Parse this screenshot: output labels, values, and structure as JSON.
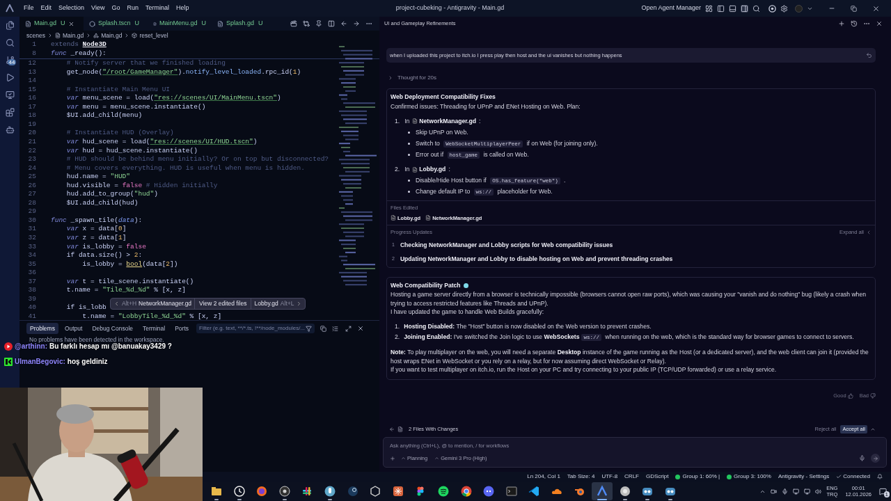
{
  "window": {
    "title": "project-cubeking - Antigravity - Main.gd"
  },
  "menu": [
    "File",
    "Edit",
    "Selection",
    "View",
    "Go",
    "Run",
    "Terminal",
    "Help"
  ],
  "titlebar": {
    "agent_manager": "Open Agent Manager"
  },
  "activity_bar": {
    "source_control_badge": "44"
  },
  "editor": {
    "tabs": [
      {
        "label": "Main.gd",
        "status": "U",
        "kind": "script",
        "selected": true
      },
      {
        "label": "Splash.tscn",
        "status": "U",
        "kind": "scene",
        "selected": false
      },
      {
        "label": "MainMenu.gd",
        "status": "U",
        "kind": "script",
        "selected": false
      },
      {
        "label": "Splash.gd",
        "status": "U",
        "kind": "script",
        "selected": false
      }
    ],
    "breadcrumb": [
      {
        "kind": "folder",
        "text": "scenes"
      },
      {
        "kind": "file",
        "text": "Main.gd"
      },
      {
        "kind": "class",
        "text": "Main.gd"
      },
      {
        "kind": "method",
        "text": "reset_level"
      }
    ],
    "sticky_lines": [
      {
        "number": "1",
        "tokens": [
          {
            "kind": "dim",
            "text": "extends "
          },
          {
            "kind": "type",
            "text": "Node3D"
          }
        ]
      },
      {
        "number": "8",
        "tokens": [
          {
            "kind": "keyword",
            "text": "func"
          },
          {
            "kind": "plain",
            "text": " _ready():"
          }
        ]
      }
    ],
    "lines": [
      {
        "number": "12",
        "tokens": [
          {
            "kind": "comment",
            "text": "    # Notify server that we finished loading"
          }
        ]
      },
      {
        "number": "13",
        "tokens": [
          {
            "kind": "plain",
            "text": "    get_node("
          },
          {
            "kind": "string",
            "text": "\"/root/GameManager\""
          },
          {
            "kind": "plain",
            "text": ")."
          },
          {
            "kind": "method",
            "text": "notify_level_loaded"
          },
          {
            "kind": "plain",
            "text": ".rpc_id("
          },
          {
            "kind": "number",
            "text": "1"
          },
          {
            "kind": "plain",
            "text": ")"
          }
        ]
      },
      {
        "number": "14"
      },
      {
        "number": "15",
        "tokens": [
          {
            "kind": "comment",
            "text": "    # Instantiate Main Menu UI"
          }
        ]
      },
      {
        "number": "16",
        "tokens": [
          {
            "kind": "keyword",
            "text": "    var"
          },
          {
            "kind": "plain",
            "text": " menu_scene = load("
          },
          {
            "kind": "string",
            "text": "\"res://scenes/UI/MainMenu.tscn\""
          },
          {
            "kind": "plain",
            "text": ")"
          }
        ]
      },
      {
        "number": "17",
        "tokens": [
          {
            "kind": "keyword",
            "text": "    var"
          },
          {
            "kind": "plain",
            "text": " menu = menu_scene.instantiate()"
          }
        ]
      },
      {
        "number": "18",
        "tokens": [
          {
            "kind": "plain",
            "text": "    $UI.add_child(menu)"
          }
        ]
      },
      {
        "number": "19"
      },
      {
        "number": "20",
        "tokens": [
          {
            "kind": "comment",
            "text": "    # Instantiate HUD (Overlay)"
          }
        ]
      },
      {
        "number": "21",
        "tokens": [
          {
            "kind": "keyword",
            "text": "    var"
          },
          {
            "kind": "plain",
            "text": " hud_scene = load("
          },
          {
            "kind": "string",
            "text": "\"res://scenes/UI/HUD.tscn\""
          },
          {
            "kind": "plain",
            "text": ")"
          }
        ]
      },
      {
        "number": "22",
        "tokens": [
          {
            "kind": "keyword",
            "text": "    var"
          },
          {
            "kind": "plain",
            "text": " hud = hud_scene.instantiate()"
          }
        ]
      },
      {
        "number": "23",
        "tokens": [
          {
            "kind": "comment",
            "text": "    # HUD should be behind menu initially? Or on top but disconnected?"
          }
        ]
      },
      {
        "number": "24",
        "tokens": [
          {
            "kind": "comment",
            "text": "    # Menu covers everything. HUD is useful when menu is hidden."
          }
        ]
      },
      {
        "number": "25",
        "tokens": [
          {
            "kind": "plain",
            "text": "    hud.name = "
          },
          {
            "kind": "string2",
            "text": "\"HUD\""
          }
        ]
      },
      {
        "number": "26",
        "tokens": [
          {
            "kind": "plain",
            "text": "    hud.visible = "
          },
          {
            "kind": "bool",
            "text": "false"
          },
          {
            "kind": "comment",
            "text": " # Hidden initially"
          }
        ]
      },
      {
        "number": "27",
        "tokens": [
          {
            "kind": "plain",
            "text": "    hud.add_to_group("
          },
          {
            "kind": "string2",
            "text": "\"hud\""
          },
          {
            "kind": "plain",
            "text": ")"
          }
        ]
      },
      {
        "number": "28",
        "tokens": [
          {
            "kind": "plain",
            "text": "    $UI.add_child(hud)"
          }
        ]
      },
      {
        "number": "29"
      },
      {
        "number": "30",
        "tokens": [
          {
            "kind": "keyword",
            "text": "func"
          },
          {
            "kind": "plain",
            "text": " _spawn_tile("
          },
          {
            "kind": "param",
            "text": "data"
          },
          {
            "kind": "plain",
            "text": "):"
          }
        ]
      },
      {
        "number": "31",
        "tokens": [
          {
            "kind": "keyword",
            "text": "    var"
          },
          {
            "kind": "plain",
            "text": " x = data["
          },
          {
            "kind": "number",
            "text": "0"
          },
          {
            "kind": "plain",
            "text": "]"
          }
        ]
      },
      {
        "number": "32",
        "tokens": [
          {
            "kind": "keyword",
            "text": "    var"
          },
          {
            "kind": "plain",
            "text": " z = data["
          },
          {
            "kind": "number",
            "text": "1"
          },
          {
            "kind": "plain",
            "text": "]"
          }
        ]
      },
      {
        "number": "33",
        "tokens": [
          {
            "kind": "keyword",
            "text": "    var"
          },
          {
            "kind": "plain",
            "text": " is_lobby = "
          },
          {
            "kind": "bool",
            "text": "false"
          }
        ]
      },
      {
        "number": "34",
        "tokens": [
          {
            "kind": "plain",
            "text": "    if data.size() > "
          },
          {
            "kind": "number",
            "text": "2"
          },
          {
            "kind": "plain",
            "text": ":"
          }
        ]
      },
      {
        "number": "35",
        "tokens": [
          {
            "kind": "plain",
            "text": "        is_lobby = "
          },
          {
            "kind": "call",
            "text": "bool"
          },
          {
            "kind": "plain",
            "text": "(data["
          },
          {
            "kind": "number",
            "text": "2"
          },
          {
            "kind": "plain",
            "text": "])"
          }
        ]
      },
      {
        "number": "36"
      },
      {
        "number": "37",
        "tokens": [
          {
            "kind": "keyword",
            "text": "    var"
          },
          {
            "kind": "plain",
            "text": " t = tile_scene.instantiate()"
          }
        ]
      },
      {
        "number": "38",
        "tokens": [
          {
            "kind": "plain",
            "text": "    t.name = "
          },
          {
            "kind": "string2",
            "text": "\"Tile_%d_%d\""
          },
          {
            "kind": "plain",
            "text": " % [x, z]"
          }
        ]
      },
      {
        "number": "39"
      },
      {
        "number": "40",
        "tokens": [
          {
            "kind": "plain",
            "text": "    if is_lobb"
          }
        ]
      },
      {
        "number": "41",
        "tokens": [
          {
            "kind": "plain",
            "text": "        t.name = "
          },
          {
            "kind": "string2",
            "text": "\"LobbyTile_%d_%d\""
          },
          {
            "kind": "plain",
            "text": " % [x, z]"
          }
        ]
      }
    ],
    "popup": {
      "prev_shortcut": "Alt+H",
      "prev_file": "NetworkManager.gd",
      "middle": "View 2 edited files",
      "next_file": "Lobby.gd",
      "next_shortcut": "Alt+L"
    }
  },
  "panel": {
    "tabs": [
      {
        "label": "Problems",
        "selected": true
      },
      {
        "label": "Output",
        "selected": false
      },
      {
        "label": "Debug Console",
        "selected": false
      },
      {
        "label": "Terminal",
        "selected": false
      },
      {
        "label": "Ports",
        "selected": false
      }
    ],
    "filter_placeholder": "Filter (e.g. text, **/*.ts, !**/node_modules/...",
    "message": "No problems have been detected in the workspace."
  },
  "chat_overlay": [
    {
      "kind": "youtube",
      "user": "@arthinn:",
      "text": "Bu farklı hesap mı @banuakay3429 ?"
    },
    {
      "kind": "kick",
      "user": "UlmanBegovic:",
      "text": "hoş geldiniz"
    }
  ],
  "webcam": {
    "kind": "picture"
  },
  "agent": {
    "title": "UI and Gameplay Refinements",
    "user_message": "when I uploaded this project to itch.io I press play then host and the ui vanishes but nothing happens",
    "thought": {
      "text": "Thought for 20s",
      "expanded": false
    },
    "plan": {
      "title": "Web Deployment Compatibility Fixes",
      "intro": "Confirmed issues: Threading for UPnP and ENet Hosting on Web. Plan:",
      "steps": [
        {
          "number": "1.",
          "prefix": "In",
          "file": "NetworkManager.gd",
          "suffix": ":",
          "bullets": [
            [
              {
                "kind": "text",
                "text": "Skip UPnP on Web."
              }
            ],
            [
              {
                "kind": "text",
                "text": "Switch to "
              },
              {
                "kind": "code",
                "text": "WebSocketMultiplayerPeer"
              },
              {
                "kind": "text",
                "text": " if on Web (for joining only)."
              }
            ],
            [
              {
                "kind": "text",
                "text": "Error out if "
              },
              {
                "kind": "code",
                "text": "host_game"
              },
              {
                "kind": "text",
                "text": " is called on Web."
              }
            ]
          ]
        },
        {
          "number": "2.",
          "prefix": "In",
          "file": "Lobby.gd",
          "suffix": ":",
          "bullets": [
            [
              {
                "kind": "text",
                "text": "Disable/Hide Host button if "
              },
              {
                "kind": "code",
                "text": "OS.has_feature(\"web\")"
              },
              {
                "kind": "text",
                "text": " ."
              }
            ],
            [
              {
                "kind": "text",
                "text": "Change default IP to "
              },
              {
                "kind": "code",
                "text": "ws://"
              },
              {
                "kind": "text",
                "text": " placeholder for Web."
              }
            ]
          ]
        }
      ]
    },
    "files_edited": {
      "label": "Files Edited",
      "files": [
        "Lobby.gd",
        "NetworkManager.gd"
      ]
    },
    "progress": {
      "label": "Progress Updates",
      "expand": "Expand all",
      "items": [
        {
          "number": "1",
          "text": "Checking NetworkManager and Lobby scripts for Web compatibility issues"
        },
        {
          "number": "2",
          "text": "Updating NetworkManager and Lobby to disable hosting on Web and prevent threading crashes"
        }
      ]
    },
    "patch": {
      "title": "Web Compatibility Patch",
      "blocks": [
        {
          "kind": "paragraph",
          "segments": [
            {
              "kind": "text",
              "text": "Hosting a game server directly from a browser is technically impossible (browsers cannot open raw ports), which was causing your \"vanish and do nothing\" bug (likely a crash when trying to access restricted features like Threads and UPnP)."
            }
          ]
        },
        {
          "kind": "paragraph",
          "segments": [
            {
              "kind": "text",
              "text": "I have updated the game to handle Web Builds gracefully:"
            }
          ]
        },
        {
          "kind": "list",
          "items": [
            {
              "number": "1.",
              "segments": [
                {
                  "kind": "bold",
                  "text": "Hosting Disabled:"
                },
                {
                  "kind": "text",
                  "text": " The \"Host\" button is now disabled on the Web version to prevent crashes."
                }
              ]
            },
            {
              "number": "2.",
              "segments": [
                {
                  "kind": "bold",
                  "text": "Joining Enabled:"
                },
                {
                  "kind": "text",
                  "text": " I've switched the Join logic to use "
                },
                {
                  "kind": "bold",
                  "text": "WebSockets"
                },
                {
                  "kind": "code",
                  "text": "ws://"
                },
                {
                  "kind": "text",
                  "text": " when running on the web, which is the standard way for browser games to connect to servers."
                }
              ]
            }
          ]
        },
        {
          "kind": "paragraph",
          "segments": [
            {
              "kind": "bold",
              "text": "Note:"
            },
            {
              "kind": "text",
              "text": " To play multiplayer on the web, you will need a separate "
            },
            {
              "kind": "bold",
              "text": "Desktop"
            },
            {
              "kind": "text",
              "text": " instance of the game running as the Host (or a dedicated server), and the web client can join it (provided the host wraps ENet in WebSocket or you rely on a relay, but for now assuming direct WebSocket or Relay)."
            }
          ]
        },
        {
          "kind": "paragraph",
          "segments": [
            {
              "kind": "text",
              "text": "If you want to test multiplayer on itch.io, run the Host on your PC and try connecting to your public IP (TCP/UDP forwarded) or use a relay service."
            }
          ]
        }
      ]
    },
    "feedback": {
      "good": "Good",
      "bad": "Bad"
    },
    "changes": {
      "label": "2 Files With Changes",
      "reject": "Reject all",
      "accept": "Accept all"
    },
    "input": {
      "placeholder": "Ask anything (Ctrl+L), @ to mention, / for workflows",
      "mode": "Planning",
      "model": "Gemini 3 Pro (High)"
    }
  },
  "status_bar": [
    {
      "kind": "text",
      "text": "Ln 204, Col 1"
    },
    {
      "kind": "text",
      "text": "Tab Size: 4"
    },
    {
      "kind": "text",
      "text": "UTF-8"
    },
    {
      "kind": "text",
      "text": "CRLF"
    },
    {
      "kind": "text",
      "text": "GDScript"
    },
    {
      "kind": "group",
      "text": "Group 1: 60% |"
    },
    {
      "kind": "group",
      "text": "Group 3: 100%"
    },
    {
      "kind": "text",
      "text": "Antigravity - Settings"
    },
    {
      "kind": "check",
      "text": "Connected"
    }
  ],
  "taskbar": {
    "apps": [
      {
        "kind": "folder",
        "running": true,
        "selected": false
      },
      {
        "kind": "clock",
        "running": true,
        "selected": false
      },
      {
        "kind": "firefox",
        "running": false,
        "selected": false
      },
      {
        "kind": "obs",
        "running": true,
        "selected": false
      },
      {
        "kind": "slack",
        "running": false,
        "selected": false
      },
      {
        "kind": "podcast",
        "running": true,
        "selected": false
      },
      {
        "kind": "steam",
        "running": false,
        "selected": false
      },
      {
        "kind": "unity",
        "running": false,
        "selected": false
      },
      {
        "kind": "claude",
        "running": false,
        "selected": false
      },
      {
        "kind": "figma",
        "running": false,
        "selected": false
      },
      {
        "kind": "spotify",
        "running": false,
        "selected": false
      },
      {
        "kind": "chrome",
        "running": false,
        "selected": false
      },
      {
        "kind": "discord",
        "running": false,
        "selected": false
      },
      {
        "kind": "terminal",
        "running": false,
        "selected": false
      },
      {
        "kind": "vscode",
        "running": false,
        "selected": false
      },
      {
        "kind": "cloud",
        "running": false,
        "selected": false
      },
      {
        "kind": "blender",
        "running": false,
        "selected": false
      },
      {
        "kind": "antigravity",
        "running": true,
        "selected": true
      },
      {
        "kind": "speaker",
        "running": true,
        "selected": false
      },
      {
        "kind": "godot",
        "running": true,
        "selected": false
      },
      {
        "kind": "godot",
        "running": true,
        "selected": false
      }
    ],
    "language": "ENG",
    "layout": "TRQ",
    "time": "00:01",
    "date": "12.01.2026",
    "notifications": "1"
  }
}
